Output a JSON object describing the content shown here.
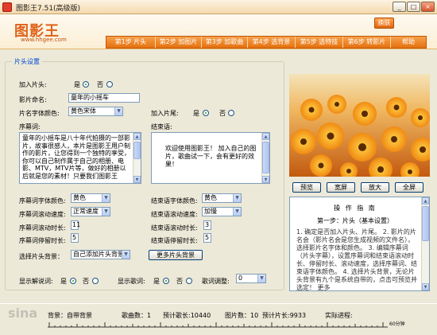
{
  "window": {
    "title": "图影王7.51(高级版)",
    "min_label": "_",
    "max_label": "□",
    "close_label": "×"
  },
  "header": {
    "logo": "图影王",
    "logo_url": "www.hhgee.com",
    "switch_label": "换肤",
    "nav": [
      "第1步 片头",
      "第2步 加图片",
      "第3步 加歌曲",
      "第4步 选背景",
      "第5步 选特技",
      "第6步 转影片",
      "帮助"
    ]
  },
  "panel": {
    "legend": "片头设置",
    "add_intro_label": "加入片头:",
    "yes": "是",
    "no": "否",
    "movie_name_label": "影片命名:",
    "movie_name_value": "童年的小摇车",
    "title_font_color_label": "片名字体颜色:",
    "title_font_color_value": "黄色宋体",
    "add_outro_label": "加入片尾:",
    "prologue_label": "序幕词:",
    "prologue_text": "童年的小摇车是八十年代拍摄的一部影片，故事很感人，本片是图影王用户制作的影片，让您得到一个独特的享受，你可以自己制作属于自己的相册、电影、MTV，MTV片等，做好的相册以后就是您的素材！只要我们图影王",
    "closing_label": "结束语:",
    "closing_text": "欢迎使用图影王！ 加入自己的图片，歌曲试一下，会有更好的效果！",
    "prologue_font_color_label": "序幕词字体颜色:",
    "prologue_font_color_value": "黄色",
    "closing_font_color_label": "结束语字体颜色:",
    "closing_font_color_value": "黄色",
    "prologue_scroll_speed_label": "序幕词滚动速度:",
    "prologue_scroll_speed_value": "正常速度",
    "closing_scroll_speed_label": "结束语滚动速度:",
    "closing_scroll_speed_value": "加慢",
    "prologue_scroll_time_label": "序幕词滚动时长:",
    "prologue_scroll_time_value": "11",
    "closing_scroll_time_label": "结束语滚动时长:",
    "closing_scroll_time_value": "3",
    "prologue_stay_time_label": "序幕词停留时长:",
    "prologue_stay_time_value": "5",
    "closing_stay_time_label": "结束语停留时长:",
    "closing_stay_time_value": "5",
    "intro_bg_label": "选择片头背景：",
    "intro_bg_value": "自己添加片头背景",
    "more_bg_button": "更多片头背景",
    "show_lyrics_label": "显示解说词:",
    "show_song_lyrics_label": "显示歌词:",
    "lyrics_adjust_label": "歌词调整:",
    "lyrics_adjust_value": "0"
  },
  "preview": {
    "buttons": [
      "预览",
      "宽屏",
      "放大",
      "全屏"
    ]
  },
  "guide": {
    "title": "操 作 指 南",
    "step": "第一步：片头（基本设置）",
    "body": "1. 确定是否加入片头、片尾。 2. 影片的片名会（影片名会是您生成视频的文件名），选择影片名字体和颜色。 3. 编辑序幕词（片头字幕），设置序幕词和结束语滚动时长、停留时长、滚动速度，选择序幕词、结束语字体颜色。 4. 选择片头背景，无论片头背景有九个是系统自带的，点击可预览并选定！ 更多"
  },
  "status": {
    "music_label": "背景：",
    "music_value": "自带背景",
    "songs_label": "歌曲数：",
    "songs_value": "1",
    "song_length_label": "预计歌长:",
    "song_length_value": "10440",
    "pics_label": "图片数：",
    "pics_value": "10",
    "movie_length_label": "预计片长:",
    "movie_length_value": "9933",
    "progress_label": "实际进程:",
    "ruler_end": "60分钟",
    "watermark": "sina"
  },
  "colors": {
    "accent": "#e5710f",
    "legend": "#0046d5"
  }
}
